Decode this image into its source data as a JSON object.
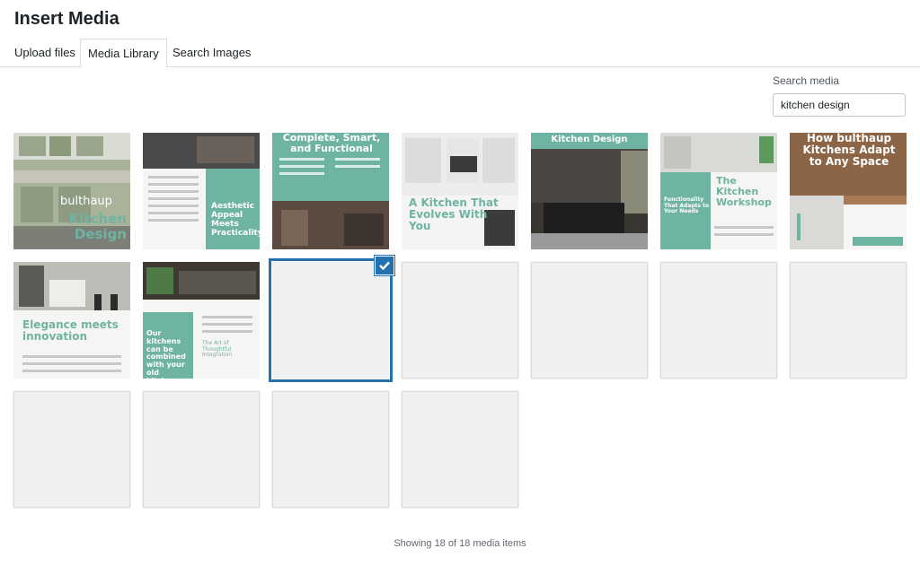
{
  "modal": {
    "title": "Insert Media"
  },
  "tabs": [
    {
      "label": "Upload files"
    },
    {
      "label": "Media Library",
      "active": true
    },
    {
      "label": "Search Images"
    }
  ],
  "search": {
    "label": "Search media",
    "value": "kitchen design"
  },
  "thumbnails": [
    {
      "title": "Kitchen Design",
      "subtitle": "bulthaup"
    },
    {
      "title": "Aesthetic Appeal Meets Practicality"
    },
    {
      "title": "Complete, Smart, and Functional"
    },
    {
      "title": "A Kitchen That Evolves With You"
    },
    {
      "title": "Kitchen Design"
    },
    {
      "title": "The Kitchen Workshop",
      "subtitle": "Functionality That Adapts to Your Needs"
    },
    {
      "title": "How bulthaup Kitchens Adapt to Any Space"
    },
    {
      "title": "Elegance meets innovation"
    },
    {
      "title": "Our kitchens can be combined with your old kitchen",
      "subtitle": "The Art of Thoughtful Integration"
    }
  ],
  "selected_index": 9,
  "footer": {
    "status": "Showing 18 of 18 media items"
  },
  "colors": {
    "accent": "#2271b1",
    "teal": "#6fb3a2"
  }
}
